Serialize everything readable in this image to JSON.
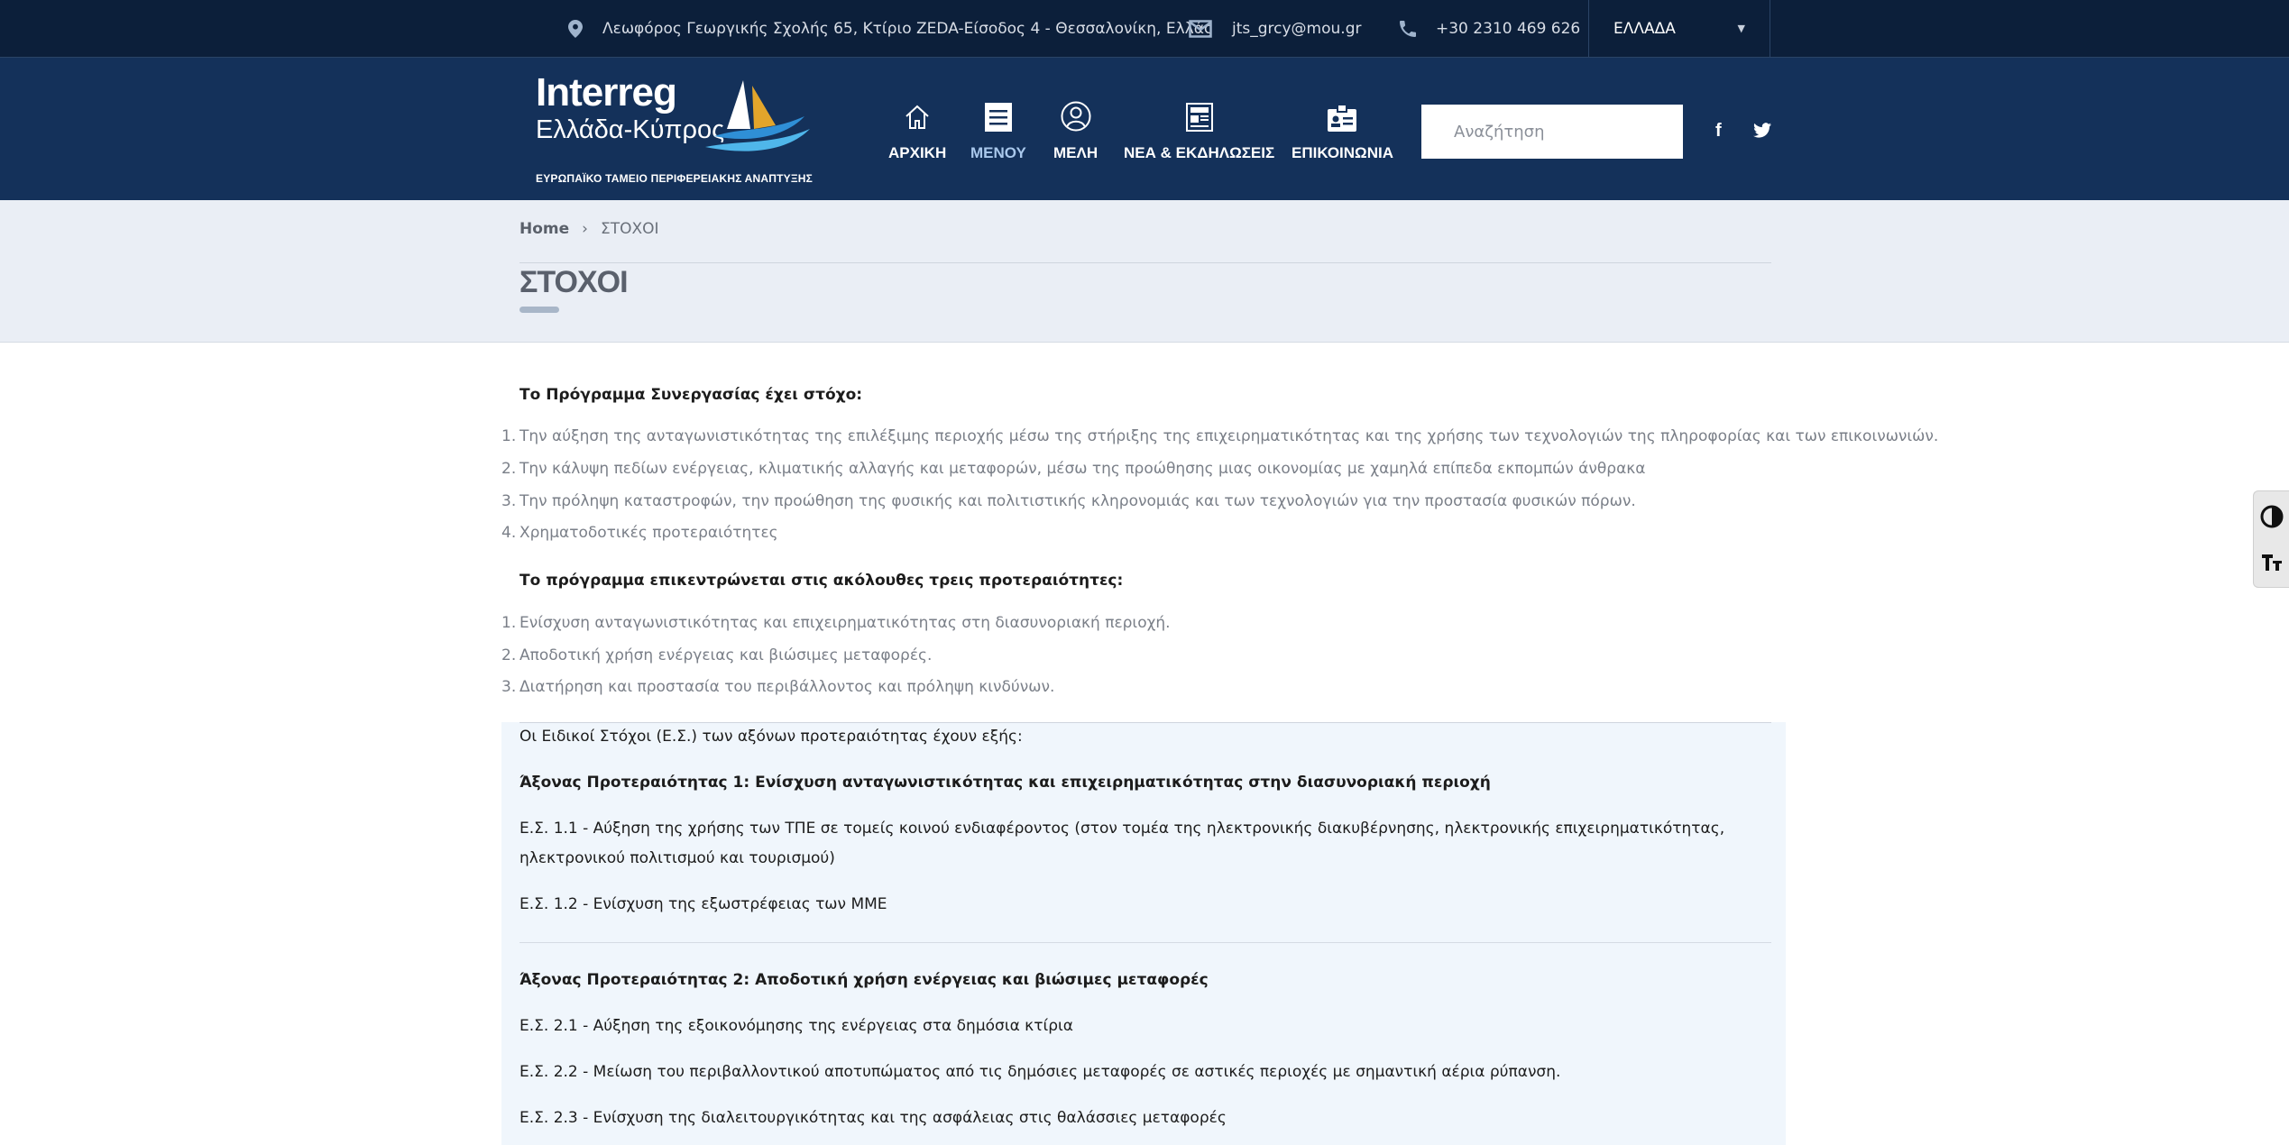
{
  "topbar": {
    "address": "Λεωφόρος Γεωργικής Σχολής 65, Κτίριο ZEDA-Είσοδος 4 - Θεσσαλονίκη, Ελλάς",
    "email": "jts_grcy@mou.gr",
    "phone": "+30 2310 469 626",
    "language": "ΕΛΛΑΔΑ"
  },
  "logo": {
    "line1": "Interreg",
    "line2": "Ελλάδα-Κύπρος",
    "line3": "ΕΥΡΩΠΑΪΚΟ ΤΑΜΕΙΟ ΠΕΡΙΦΕΡΕΙΑΚΗΣ ΑΝΑΠΤΥΞΗΣ"
  },
  "nav": [
    {
      "label": "ΑΡΧΙΚΗ",
      "icon": "home-icon"
    },
    {
      "label": "ΜΕΝΟΥ",
      "icon": "document-icon",
      "active": true
    },
    {
      "label": "ΜΕΛΗ",
      "icon": "user-icon"
    },
    {
      "label": "ΝΕΑ & ΕΚΔΗΛΩΣΕΙΣ",
      "icon": "newspaper-icon"
    },
    {
      "label": "ΕΠΙΚΟΙΝΩΝΙΑ",
      "icon": "contact-card-icon"
    }
  ],
  "search": {
    "placeholder": "Αναζήτηση"
  },
  "social": {
    "facebook": "f",
    "twitter": "twitter-icon"
  },
  "breadcrumb": {
    "home": "Home",
    "current": "ΣΤΟΧΟΙ"
  },
  "page": {
    "title": "ΣΤΟΧΟΙ"
  },
  "content": {
    "intro1": "Το Πρόγραμμα Συνεργασίας έχει στόχο:",
    "goals": [
      "Την αύξηση της ανταγωνιστικότητας της επιλέξιμης περιοχής μέσω της στήριξης της επιχειρηματικότητας και της χρήσης των τεχνολογιών της πληροφορίας και των επικοινωνιών.",
      "Την κάλυψη πεδίων ενέργειας, κλιματικής αλλαγής και μεταφορών, μέσω της προώθησης μιας οικονομίας με χαμηλά επίπεδα εκπομπών άνθρακα",
      "Την πρόληψη καταστροφών, την προώθηση της φυσικής και πολιτιστικής κληρονομιάς και των τεχνολογιών για την προστασία φυσικών πόρων.",
      "Χρηματοδοτικές προτεραιότητες"
    ],
    "intro2": "Το πρόγραμμα επικεντρώνεται στις ακόλουθες τρεις προτεραιότητες:",
    "priorities": [
      "Ενίσχυση ανταγωνιστικότητας και επιχειρηματικότητας στη διασυνοριακή περιοχή.",
      "Αποδοτική χρήση ενέργειας και βιώσιμες μεταφορές.",
      "Διατήρηση και προστασία του περιβάλλοντος και πρόληψη κινδύνων."
    ],
    "specific_intro": "Οι Ειδικοί Στόχοι (Ε.Σ.) των αξόνων προτεραιότητας έχουν εξής:",
    "axis1_title": "Άξονας Προτεραιότητας 1: Ενίσχυση ανταγωνιστικότητας και επιχειρηματικότητας στην διασυνοριακή περιοχή",
    "axis1_items": [
      "Ε.Σ. 1.1 - Αύξηση της χρήσης των ΤΠΕ σε τομείς κοινού ενδιαφέροντος (στον τομέα της ηλεκτρονικής διακυβέρνησης, ηλεκτρονικής επιχειρηματικότητας, ηλεκτρονικού πολιτισμού και τουρισμού)",
      "Ε.Σ. 1.2 - Ενίσχυση της εξωστρέφειας των ΜΜΕ"
    ],
    "axis2_title": "Άξονας Προτεραιότητας 2: Αποδοτική χρήση ενέργειας και βιώσιμες μεταφορές",
    "axis2_items": [
      "Ε.Σ. 2.1 - Αύξηση της εξοικονόμησης της ενέργειας στα δημόσια κτίρια",
      "Ε.Σ. 2.2 - Μείωση του περιβαλλοντικού αποτυπώματος από τις δημόσιες μεταφορές σε αστικές περιοχές με σημαντική αέρια ρύπανση.",
      "Ε.Σ. 2.3 - Ενίσχυση της διαλειτουργικότητας και της ασφάλειας στις θαλάσσιες μεταφορές"
    ]
  },
  "accessibility": {
    "contrast_icon": "contrast-icon",
    "text_size_icon": "text-size-icon"
  }
}
